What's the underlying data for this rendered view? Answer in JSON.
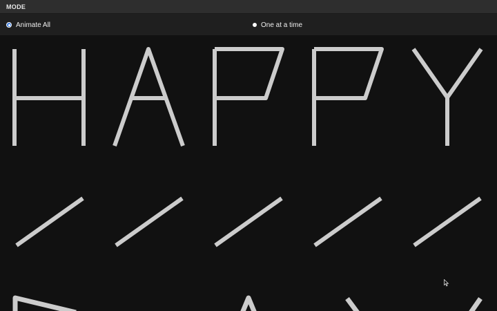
{
  "header": {
    "title": "MODE"
  },
  "mode": {
    "options": [
      {
        "label": "Animate All",
        "selected": true
      },
      {
        "label": "One at a time",
        "selected": false
      }
    ]
  },
  "stage": {
    "word": "HAPPY",
    "stroke_color": "#cccccc",
    "background": "#111111"
  },
  "colors": {
    "accent": "#3d7de0",
    "header_bg": "#2e2e2e",
    "bar_bg": "#1f1f1f"
  }
}
